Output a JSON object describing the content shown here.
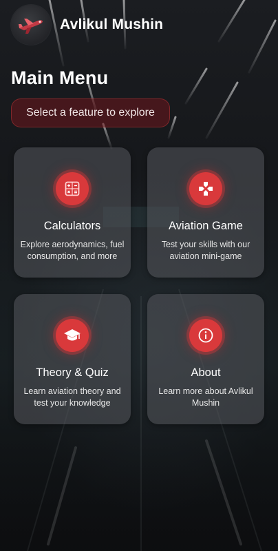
{
  "header": {
    "app_title": "Avlikul Mushin",
    "avatar_icon": "airplane-logo-icon"
  },
  "page": {
    "title": "Main Menu",
    "subtitle": "Select a feature to explore"
  },
  "cards": [
    {
      "id": "calculators",
      "title": "Calculators",
      "description": "Explore aerodynamics, fuel consumption, and more",
      "icon": "calculator-icon"
    },
    {
      "id": "aviation-game",
      "title": "Aviation Game",
      "description": "Test your skills with our aviation mini-game",
      "icon": "gamepad-icon"
    },
    {
      "id": "theory-quiz",
      "title": "Theory & Quiz",
      "description": "Learn aviation theory and test your knowledge",
      "icon": "graduation-cap-icon"
    },
    {
      "id": "about",
      "title": "About",
      "description": "Learn more about Avlikul Mushin",
      "icon": "info-icon"
    }
  ],
  "colors": {
    "accent": "#d9393b",
    "card_bg": "#55585c",
    "pill_bg": "#6e161c"
  }
}
